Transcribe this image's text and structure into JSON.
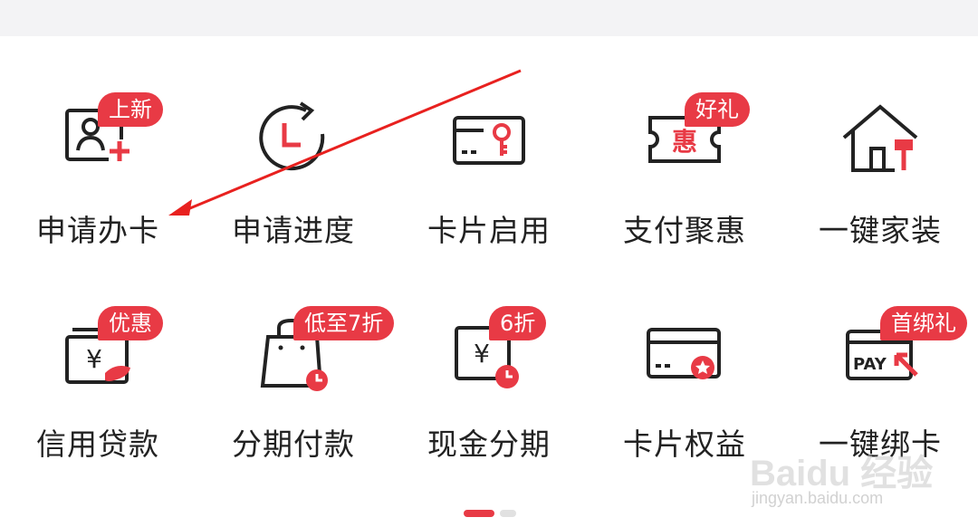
{
  "colors": {
    "accent": "#e83a45",
    "icon_stroke": "#222222",
    "label": "#222222"
  },
  "tiles": [
    {
      "label": "申请办卡",
      "badge": "上新",
      "icon": "apply-card-icon"
    },
    {
      "label": "申请进度",
      "badge": "",
      "icon": "progress-clock-icon"
    },
    {
      "label": "卡片启用",
      "badge": "",
      "icon": "card-key-icon"
    },
    {
      "label": "支付聚惠",
      "badge": "好礼",
      "icon": "coupon-ticket-icon"
    },
    {
      "label": "一键家装",
      "badge": "",
      "icon": "house-paint-icon"
    },
    {
      "label": "信用贷款",
      "badge": "优惠",
      "icon": "yuan-hand-icon"
    },
    {
      "label": "分期付款",
      "badge": "低至7折",
      "icon": "shopping-bag-clock-icon"
    },
    {
      "label": "现金分期",
      "badge": "6折",
      "icon": "yuan-clock-icon"
    },
    {
      "label": "卡片权益",
      "badge": "",
      "icon": "card-star-icon"
    },
    {
      "label": "一键绑卡",
      "badge": "首绑礼",
      "icon": "pay-card-icon"
    }
  ],
  "icon_text": {
    "coupon": "惠",
    "yuan": "¥",
    "pay": "PAY"
  },
  "pagination": {
    "pages": 2,
    "current": 1
  },
  "watermark": {
    "logo": "Baidu 经验",
    "url": "jingyan.baidu.com"
  }
}
